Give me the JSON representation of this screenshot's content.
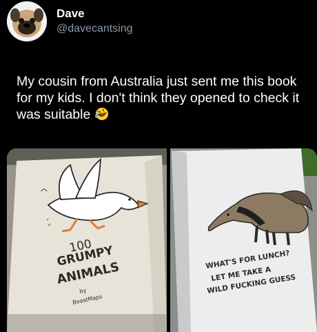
{
  "tweet": {
    "author": {
      "display_name": "Dave",
      "handle": "@davecantsing",
      "avatar_icon": "pug-avatar-icon"
    },
    "text": "My cousin from Australia just sent me this book for my kids. I don't think they opened to check it was suitable",
    "emoji": "rolling-on-floor-laughing-emoji"
  },
  "media": {
    "left_photo": {
      "title_line1": "100",
      "title_line2": "GRUMPY",
      "title_line3": "ANIMALS",
      "by": "by",
      "author": "BeastMaps",
      "illustration": "goose-icon"
    },
    "right_photo": {
      "caption_line1": "WHAT'S FOR LUNCH?",
      "caption_line2": "LET ME TAKE A",
      "caption_line3": "WILD FUCKING GUESS",
      "illustration": "anteater-icon"
    }
  },
  "colors": {
    "background": "#000000",
    "text": "#ffffff",
    "handle": "#8b98a5",
    "cover_paper": "#e7e3d8",
    "page_paper": "#ededee"
  }
}
